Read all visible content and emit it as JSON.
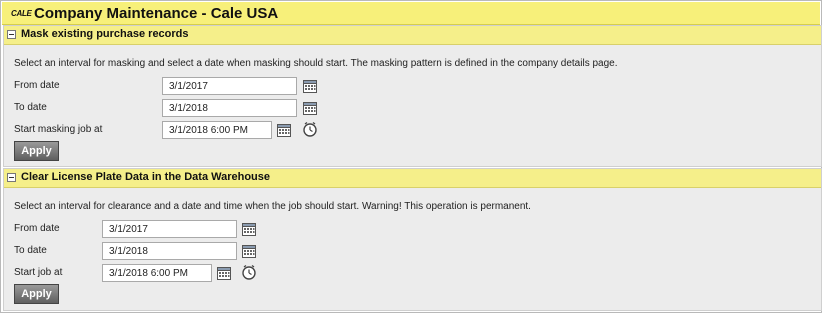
{
  "app": {
    "logo_text": "CALE",
    "title": "Company Maintenance - Cale USA"
  },
  "mask_section": {
    "title": "Mask existing purchase records",
    "description": "Select an interval for masking and select a date when masking should start. The masking pattern is defined in the company details page.",
    "from_label": "From date",
    "from_value": "3/1/2017",
    "to_label": "To date",
    "to_value": "3/1/2018",
    "start_label": "Start masking job at",
    "start_value": "3/1/2018 6:00 PM",
    "apply_label": "Apply"
  },
  "clear_section": {
    "title": "Clear License Plate Data in the Data Warehouse",
    "description": "Select an interval for clearance and a date and time when the job should start. Warning! This operation is permanent.",
    "from_label": "From date",
    "from_value": "3/1/2017",
    "to_label": "To date",
    "to_value": "3/1/2018",
    "start_label": "Start job at",
    "start_value": "3/1/2018 6:00 PM",
    "apply_label": "Apply"
  },
  "icons": {
    "calendar": "calendar-icon",
    "clock": "clock-icon",
    "collapse": "collapse-minus-icon"
  },
  "colors": {
    "titlebar": "#f7f07a",
    "section_header": "#f5ef8a",
    "panel": "#ececec",
    "button": "#6e6e6e"
  }
}
